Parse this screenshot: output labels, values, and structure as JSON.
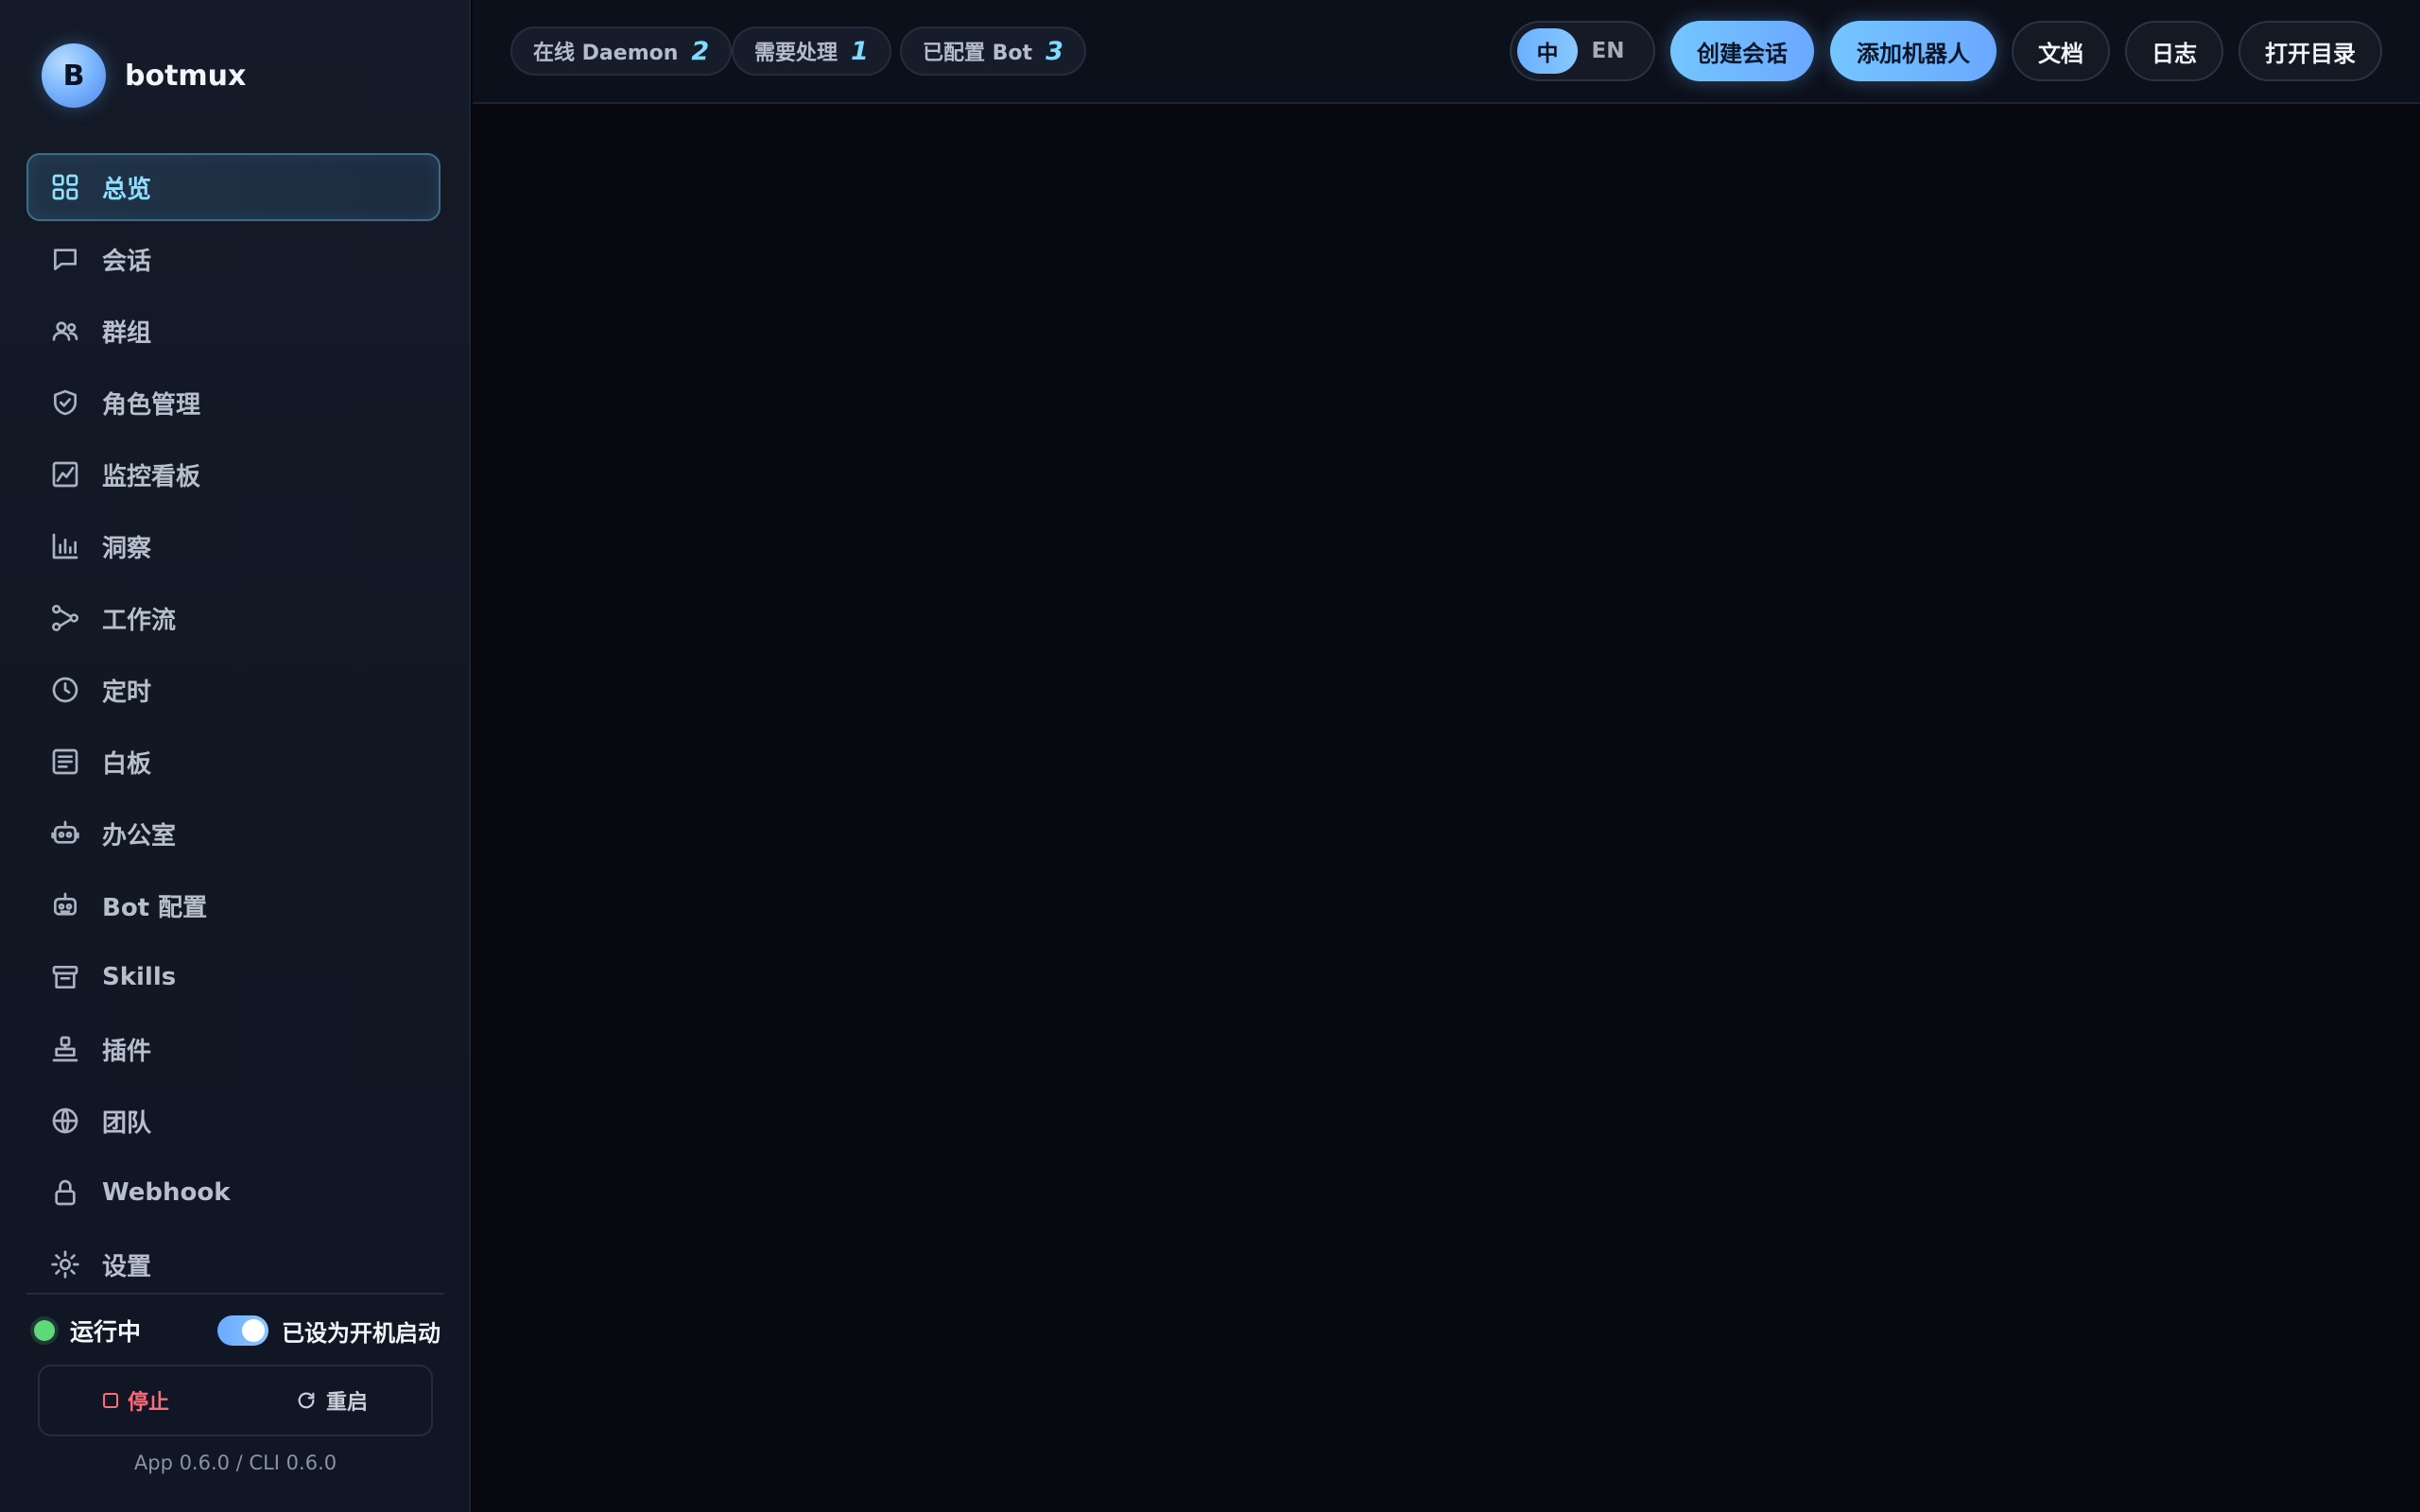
{
  "brand": {
    "logo_letter": "B",
    "name": "botmux"
  },
  "nav": {
    "items": [
      {
        "label": "总览",
        "icon": "grid-icon",
        "active": true
      },
      {
        "label": "会话",
        "icon": "chat-icon"
      },
      {
        "label": "群组",
        "icon": "users-icon"
      },
      {
        "label": "角色管理",
        "icon": "shield-icon"
      },
      {
        "label": "监控看板",
        "icon": "monitor-chart-icon"
      },
      {
        "label": "洞察",
        "icon": "bar-chart-icon"
      },
      {
        "label": "工作流",
        "icon": "workflow-icon"
      },
      {
        "label": "定时",
        "icon": "clock-icon"
      },
      {
        "label": "白板",
        "icon": "document-icon"
      },
      {
        "label": "办公室",
        "icon": "robot-icon"
      },
      {
        "label": "Bot 配置",
        "icon": "robot-config-icon"
      },
      {
        "label": "Skills",
        "icon": "archive-icon"
      },
      {
        "label": "插件",
        "icon": "plugin-icon"
      },
      {
        "label": "团队",
        "icon": "globe-icon"
      },
      {
        "label": "Webhook",
        "icon": "lock-icon"
      },
      {
        "label": "设置",
        "icon": "gear-icon"
      }
    ]
  },
  "status": {
    "running_label": "运行中",
    "autostart_label": "已设为开机启动",
    "autostart_on": true,
    "stop_label": "停止",
    "restart_label": "重启",
    "version": "App 0.6.0 / CLI 0.6.0"
  },
  "topbar": {
    "pills": [
      {
        "label": "在线 Daemon",
        "value": "2"
      },
      {
        "label": "需要处理",
        "value": "1"
      },
      {
        "label": "已配置 Bot",
        "value": "3"
      }
    ],
    "lang": {
      "zh": "中",
      "en": "EN",
      "active": "zh"
    },
    "create_session": "创建会话",
    "add_bot": "添加机器人",
    "docs": "文档",
    "logs": "日志",
    "open_dir": "打开目录"
  },
  "colors": {
    "accent": "#7fdcff",
    "primary_button": "#6aa8ff",
    "running": "#5fd879",
    "stop": "#ff6b7a",
    "background": "#07090f"
  }
}
